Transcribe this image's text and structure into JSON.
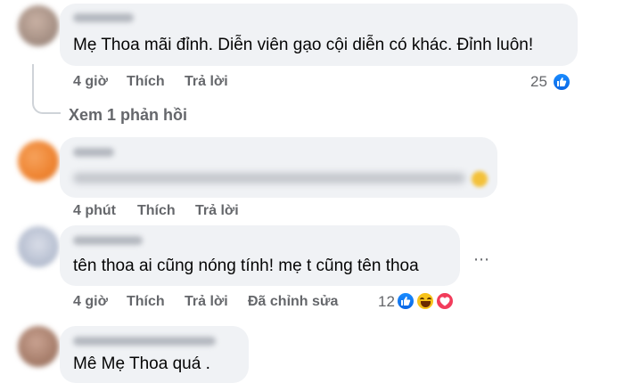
{
  "comments": [
    {
      "text": "Mẹ Thoa mãi đỉnh. Diễn viên gạo cội diễn có khác. Đỉnh luôn!",
      "time": "4 giờ",
      "like_label": "Thích",
      "reply_label": "Trả lời",
      "reaction_count": "25",
      "reactions": [
        "like-icon"
      ]
    },
    {
      "time": "4 phút",
      "like_label": "Thích",
      "reply_label": "Trả lời"
    },
    {
      "text": "tên thoa ai cũng nóng tính! mẹ t cũng tên thoa",
      "time": "4 giờ",
      "like_label": "Thích",
      "reply_label": "Trả lời",
      "edited_label": "Đã chỉnh sửa",
      "reaction_count": "12",
      "reactions": [
        "like-icon",
        "haha-icon",
        "love-icon"
      ],
      "more_icon": "ellipsis-icon"
    },
    {
      "text": "Mê Mẹ Thoa quá ."
    }
  ],
  "replies_link": "Xem 1 phản hồi",
  "colors": {
    "bubble": "#f0f2f5",
    "secondary_text": "#65676b",
    "like_blue": "#0a66e4",
    "love_red": "#f23c5b",
    "haha_yellow": "#f7c21a"
  }
}
